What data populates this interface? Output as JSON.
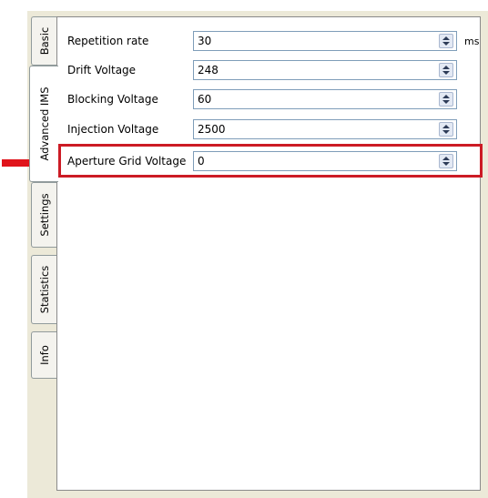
{
  "tabs": [
    {
      "label": "Basic",
      "active": false
    },
    {
      "label": "Advanced IMS",
      "active": true
    },
    {
      "label": "Settings",
      "active": false
    },
    {
      "label": "Statistics",
      "active": false
    },
    {
      "label": "Info",
      "active": false
    }
  ],
  "fields": [
    {
      "label": "Repetition rate",
      "value": "30",
      "unit": "ms"
    },
    {
      "label": "Drift Voltage",
      "value": "248"
    },
    {
      "label": "Blocking Voltage",
      "value": "60"
    },
    {
      "label": "Injection Voltage",
      "value": "2500"
    },
    {
      "label": "Aperture Grid Voltage",
      "value": "0"
    }
  ],
  "colors": {
    "highlight": "#cc1b25",
    "arrow": "#e0141b"
  },
  "icons": [
    "spin-up-icon",
    "spin-down-icon",
    "pointer-arrow-icon"
  ]
}
